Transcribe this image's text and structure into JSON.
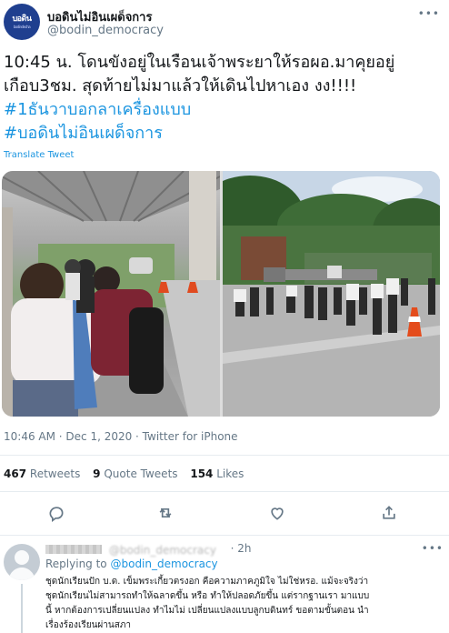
{
  "tweet": {
    "avatar_text": "บอดิน",
    "avatar_sub": "bodindecha",
    "display_name": "บอดินไม่อินเผด็จการ",
    "handle": "@bodin_democracy",
    "more_glyph": "•••",
    "text_lines": [
      "10:45 น. โดนขังอยู่ในเรือนเจ้าพระยาให้รอผอ.มาคุยอยู่",
      "เกือบ3ชม. สุดท้ายไม่มาแล้วให้เดินไปหาเอง งง!!!!"
    ],
    "hashtags": [
      "#1ธันวาบอกลาเครื่องแบบ",
      "#บอดินไม่อินเผด็จการ"
    ],
    "translate_label": "Translate Tweet",
    "timestamp": "10:46 AM · Dec 1, 2020 · Twitter for iPhone",
    "stats": [
      {
        "count": "467",
        "label": "Retweets"
      },
      {
        "count": "9",
        "label": "Quote Tweets"
      },
      {
        "count": "154",
        "label": "Likes"
      }
    ]
  },
  "reply": {
    "handle_fragment": "@bodin_democracy",
    "time": "· 2h",
    "more_glyph": "•••",
    "replying_prefix": "Replying to",
    "replying_handle": "@bodin_democracy",
    "text_lines": [
      "ชุดนักเรียนปัก บ.ด. เข็มพระเกี้ยวตรงอก คือความภาคภูมิใจ ไม่ใช่หรอ. แม้จะจริงว่า",
      "ชุดนักเรียนไม่สามารถทำให้ฉลาดขึ้น หรือ ทำให้ปลอดภัยขึ้น แต่รากฐานเรา มาแบบ",
      "นี้ หากต้องการเปลี่ยนแปลง ทำไมไม่ เปลี่ยนแปลงแบบลูกบดินทร์ ขอตามขั้นตอน นำ",
      "เรื่องร้องเรียนผ่านสภา"
    ]
  },
  "colors": {
    "link": "#1b95e0",
    "muted": "#657786",
    "text": "#14171a",
    "divider": "#e6ecf0",
    "avatar_bg": "#1f3f8f"
  },
  "icons": [
    "reply-icon",
    "retweet-icon",
    "like-icon",
    "share-icon"
  ]
}
